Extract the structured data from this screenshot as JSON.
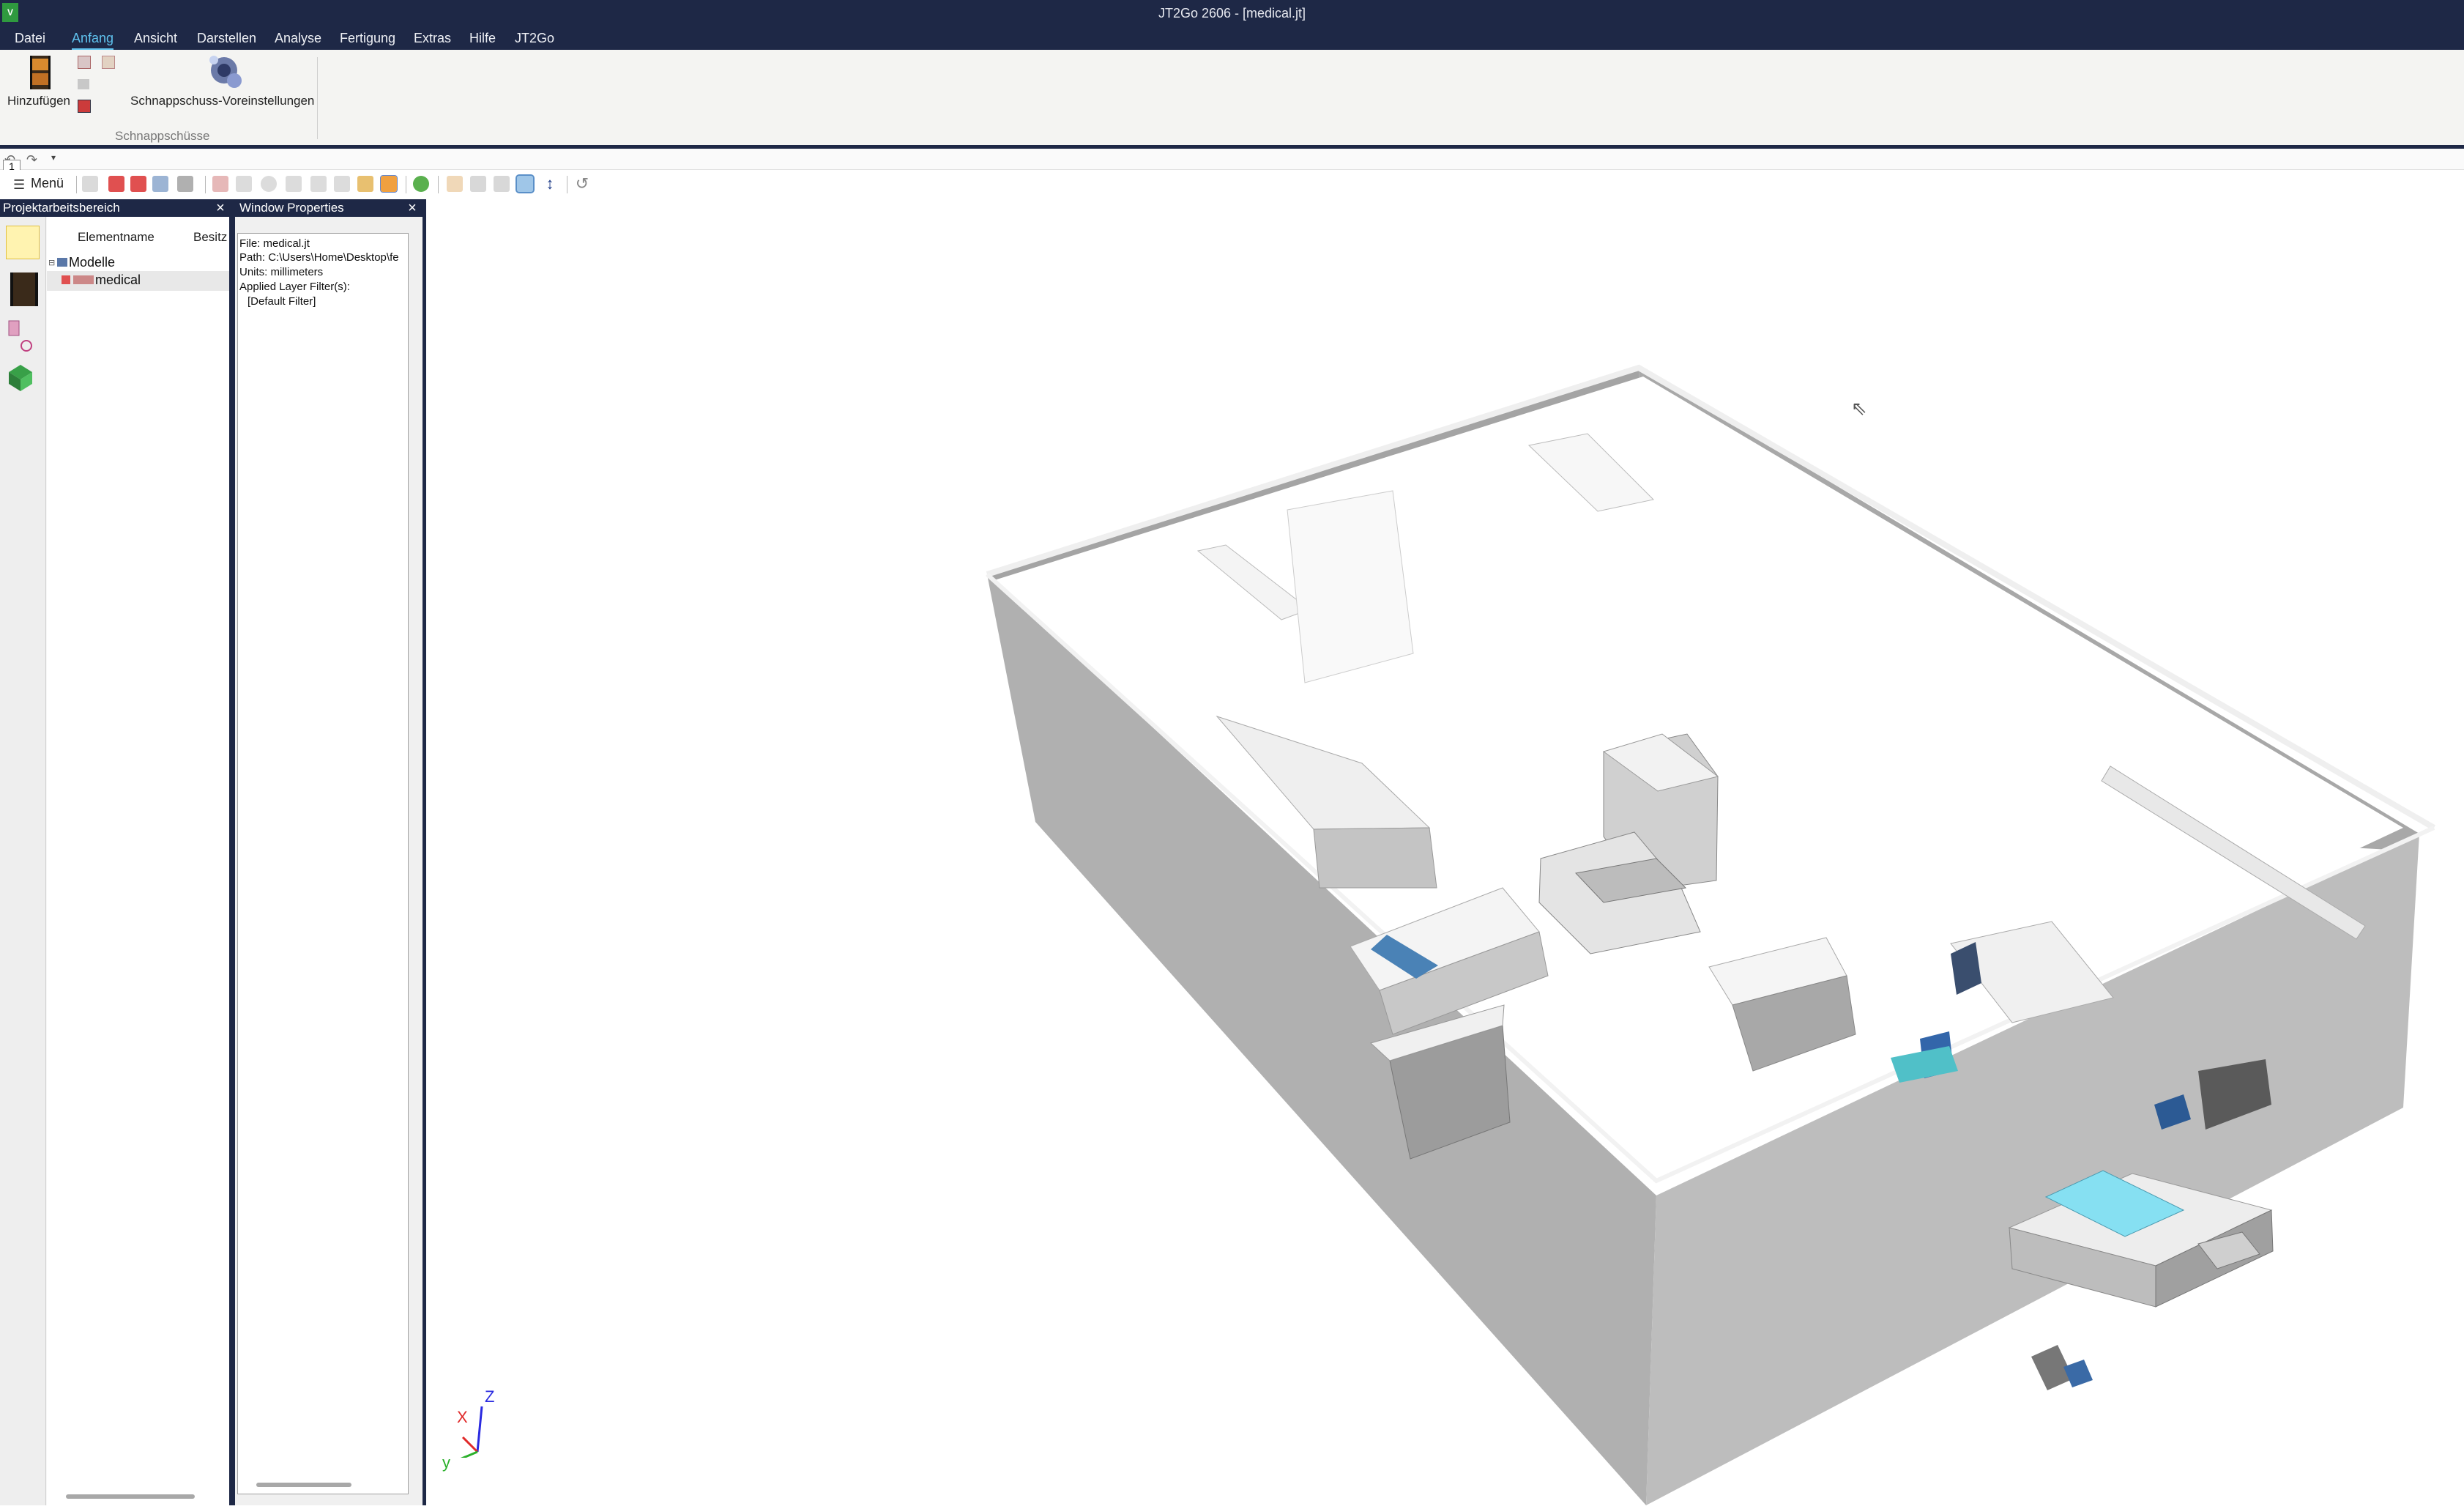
{
  "window": {
    "title": "JT2Go 2606 - [medical.jt]",
    "app_icon_text": "V"
  },
  "menu": {
    "tabs": [
      "Datei",
      "Anfang",
      "Ansicht",
      "Darstellen",
      "Analyse",
      "Fertigung",
      "Extras",
      "Hilfe",
      "JT2Go"
    ],
    "active": "Anfang"
  },
  "ribbon": {
    "add_label": "Hinzufügen",
    "snapshot_settings_label": "Schnappschuss-Voreinstellungen",
    "group_label": "Schnappschüsse"
  },
  "toolbar": {
    "menu_label": "Menü"
  },
  "project_panel": {
    "title": "Projektarbeitsbereich",
    "columns": [
      "Elementname",
      "Besitz"
    ],
    "tree": [
      {
        "label": "Modelle",
        "level": 0
      },
      {
        "label": "medical",
        "level": 1,
        "selected": true
      }
    ]
  },
  "properties_panel": {
    "title": "Window Properties",
    "lines": [
      "File: medical.jt",
      "Path: C:\\Users\\Home\\Desktop\\fe",
      "Units: millimeters",
      "Applied Layer Filter(s):",
      "[Default Filter]"
    ]
  },
  "triad": {
    "x": "X",
    "y": "y",
    "z": "Z"
  },
  "colors": {
    "titlebar": "#1e2846",
    "accent": "#5fc2ee",
    "wall": "#a8a8a8",
    "floor": "#ffffff",
    "equipment_blue": "#2f5c86",
    "equipment_cyan": "#7fd8f0"
  }
}
